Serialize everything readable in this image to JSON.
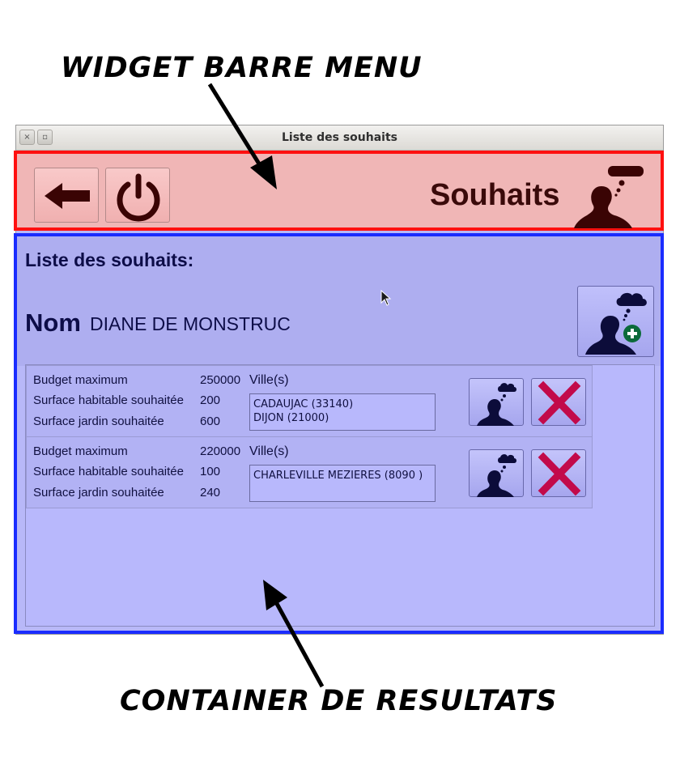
{
  "annotations": {
    "top": "WIDGET BARRE MENU",
    "bottom": "CONTAINER DE RESULTATS"
  },
  "window": {
    "title": "Liste des souhaits",
    "close_glyph": "×",
    "max_glyph": "▫"
  },
  "menubar": {
    "title": "Souhaits",
    "back_icon": "back-arrow-icon",
    "power_icon": "power-icon",
    "logo_icon": "thinking-person-icon",
    "color_bg": "#f0b6b6",
    "color_border": "#ff1010"
  },
  "results": {
    "heading": "Liste des souhaits:",
    "nom_label": "Nom",
    "nom_value": "DIANE DE MONSTRUC",
    "add_icon": "add-wish-person-icon",
    "color_border": "#1a2cff",
    "wishes": [
      {
        "budget_label": "Budget maximum",
        "budget_value": "250000",
        "surface_label": "Surface habitable souhaitée",
        "surface_value": "200",
        "jardin_label": "Surface jardin souhaitée",
        "jardin_value": "600",
        "villes_label": "Ville(s)",
        "villes": [
          "CADAUJAC (33140)",
          "DIJON (21000)"
        ]
      },
      {
        "budget_label": "Budget maximum",
        "budget_value": "220000",
        "surface_label": "Surface habitable souhaitée",
        "surface_value": "100",
        "jardin_label": "Surface jardin souhaitée",
        "jardin_value": "240",
        "villes_label": "Ville(s)",
        "villes": [
          "CHARLEVILLE MEZIERES (8090 )",
          ""
        ]
      }
    ]
  }
}
